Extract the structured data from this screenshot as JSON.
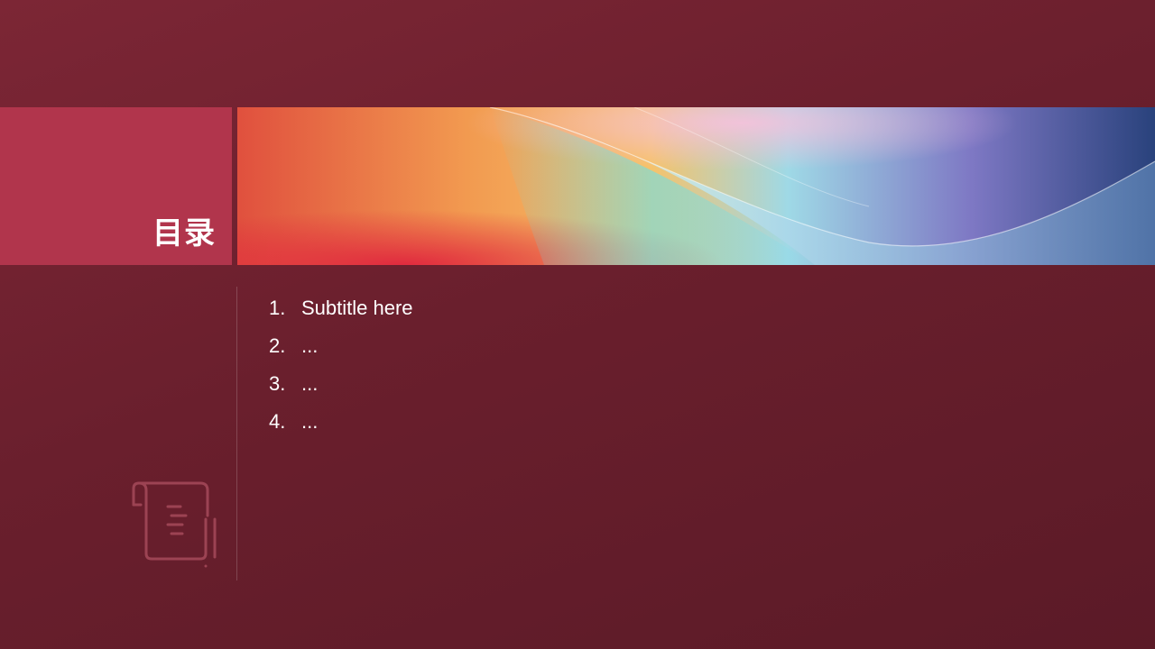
{
  "slide": {
    "title": "目录",
    "items": [
      {
        "number": "1.",
        "text": "Subtitle here"
      },
      {
        "number": "2.",
        "text": "..."
      },
      {
        "number": "3.",
        "text": "..."
      },
      {
        "number": "4.",
        "text": "..."
      }
    ]
  },
  "colors": {
    "background": "#6a1f2d",
    "title_block": "#b1354c",
    "text": "#ffffff"
  },
  "icons": {
    "decorative": "document-scroll-icon"
  }
}
